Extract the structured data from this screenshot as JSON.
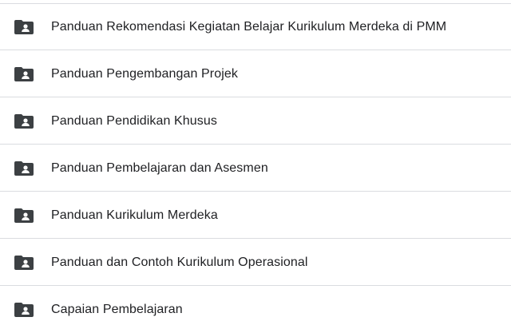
{
  "folders": [
    {
      "name": "Panduan Rekomendasi Kegiatan Belajar Kurikulum Merdeka di PMM",
      "icon": "shared-folder-icon"
    },
    {
      "name": "Panduan Pengembangan Projek",
      "icon": "shared-folder-icon"
    },
    {
      "name": "Panduan Pendidikan Khusus",
      "icon": "shared-folder-icon"
    },
    {
      "name": "Panduan Pembelajaran dan Asesmen",
      "icon": "shared-folder-icon"
    },
    {
      "name": "Panduan Kurikulum Merdeka",
      "icon": "shared-folder-icon"
    },
    {
      "name": "Panduan dan Contoh Kurikulum Operasional",
      "icon": "shared-folder-icon"
    },
    {
      "name": "Capaian Pembelajaran",
      "icon": "shared-folder-icon"
    }
  ],
  "colors": {
    "icon": "#3c4043",
    "text": "#202124",
    "divider": "#dadce0"
  }
}
